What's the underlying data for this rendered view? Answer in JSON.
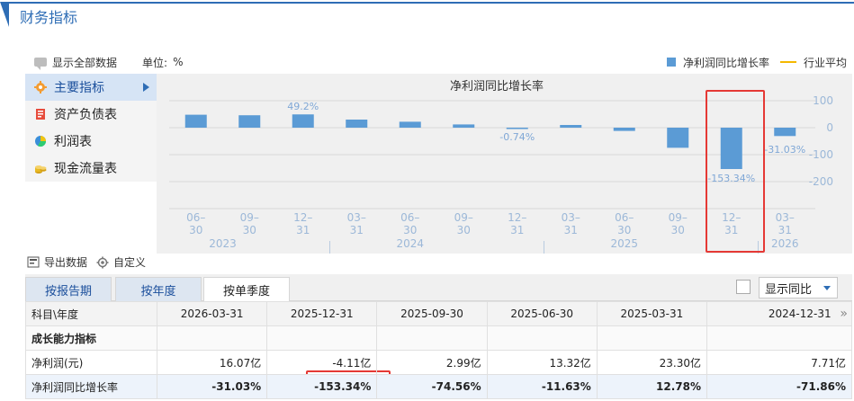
{
  "page": {
    "title": "财务指标",
    "show_all_label": "显示全部数据",
    "unit_label": "单位:",
    "unit_value": "%",
    "legend_bar_label": "净利润同比增长率",
    "legend_line_label": "行业平均"
  },
  "menu": {
    "items": [
      {
        "label": "主要指标",
        "icon": "gear-icon",
        "active": true
      },
      {
        "label": "资产负债表",
        "icon": "balance-sheet-icon",
        "active": false
      },
      {
        "label": "利润表",
        "icon": "pie-chart-icon",
        "active": false
      },
      {
        "label": "现金流量表",
        "icon": "coins-icon",
        "active": false
      }
    ]
  },
  "chart_data": {
    "type": "bar",
    "title": "净利润同比增长率",
    "categories": [
      "06-30",
      "09-30",
      "12-31",
      "03-31",
      "06-30",
      "09-30",
      "12-31",
      "03-31",
      "06-30",
      "09-30",
      "12-31",
      "03-31"
    ],
    "year_labels": [
      "2023",
      "2024",
      "2025",
      "2026"
    ],
    "series": [
      {
        "name": "净利润同比增长率",
        "values": [
          48,
          46,
          49.2,
          30,
          22,
          12,
          -0.74,
          10,
          -12,
          -74.56,
          -153.34,
          -31.03
        ],
        "color": "#5b9bd5"
      }
    ],
    "data_labels": [
      {
        "index": 2,
        "text": "49.2%"
      },
      {
        "index": 6,
        "text": "-0.74%"
      },
      {
        "index": 10,
        "text": "-153.34%"
      },
      {
        "index": 11,
        "text": "-31.03%"
      }
    ],
    "y_ticks": [
      "100",
      "0",
      "-100",
      "-200"
    ],
    "ylim": [
      -300,
      100
    ],
    "grid": true
  },
  "toolbar": {
    "export_label": "导出数据",
    "custom_label": "自定义"
  },
  "tabs": {
    "items": [
      "按报告期",
      "按年度",
      "按单季度"
    ],
    "selected": 2,
    "compare_select_value": "显示同比"
  },
  "table": {
    "header_first": "科目\\年度",
    "columns": [
      "2026-03-31",
      "2025-12-31",
      "2025-09-30",
      "2025-06-30",
      "2025-03-31",
      "2024-12-31"
    ],
    "more_label": "»",
    "rows": [
      {
        "label": "成长能力指标",
        "values": [
          "",
          "",
          "",
          "",
          "",
          ""
        ]
      },
      {
        "label": "净利润(元)",
        "values": [
          "16.07亿",
          "-4.11亿",
          "2.99亿",
          "13.32亿",
          "23.30亿",
          "7.71亿"
        ]
      },
      {
        "label": "净利润同比增长率",
        "values": [
          "-31.03%",
          "-153.34%",
          "-74.56%",
          "-11.63%",
          "12.78%",
          "-71.86%"
        ]
      }
    ]
  },
  "colors": {
    "accent": "#2e6db5",
    "bar": "#5b9bd5",
    "highlight": "#e53935",
    "industry_line": "#f5b800"
  }
}
